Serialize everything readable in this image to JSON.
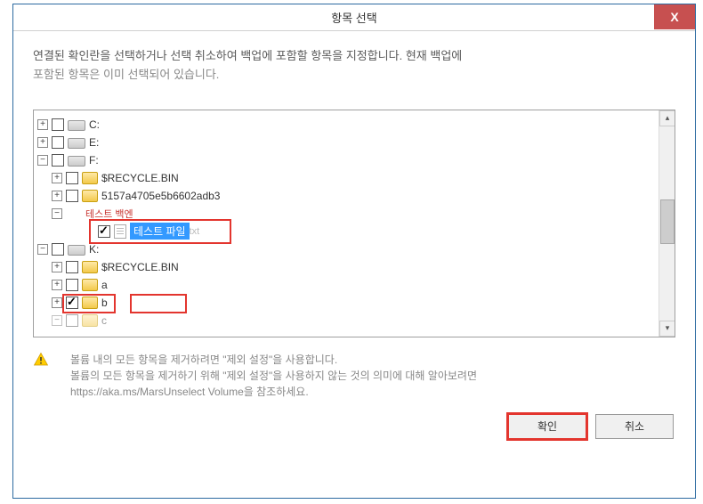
{
  "window": {
    "title": "항목 선택",
    "close_label": "X"
  },
  "description": {
    "line1": "연결된 확인란을 선택하거나 선택 취소하여 백업에 포함할 항목을 지정합니다. 현재 백업에",
    "line2": "포함된 항목은 이미 선택되어 있습니다."
  },
  "tree": {
    "drive_c": "C:",
    "drive_e": "E:",
    "drive_f": "F:",
    "recycle1": "$RECYCLE.BIN",
    "guid_folder": "5157a4705e5b6602adb3",
    "test_backup": "테스트 백엔",
    "test_file": "테스트 파일",
    "test_file_ext": "txt",
    "drive_k": "K:",
    "recycle2": "$RECYCLE.BIN",
    "folder_a": "a",
    "folder_b": "b",
    "folder_c": "c"
  },
  "footer": {
    "line1": "볼륨 내의 모든 항목을 제거하려면 \"제외 설정\"을 사용합니다.",
    "line2": "볼륨의 모든 항목을 제거하기 위해 \"제외 설정\"을 사용하지 않는 것의 의미에 대해 알아보려면",
    "line3": "https://aka.ms/MarsUnselect Volume을 참조하세요."
  },
  "buttons": {
    "ok": "확인",
    "cancel": "취소"
  }
}
